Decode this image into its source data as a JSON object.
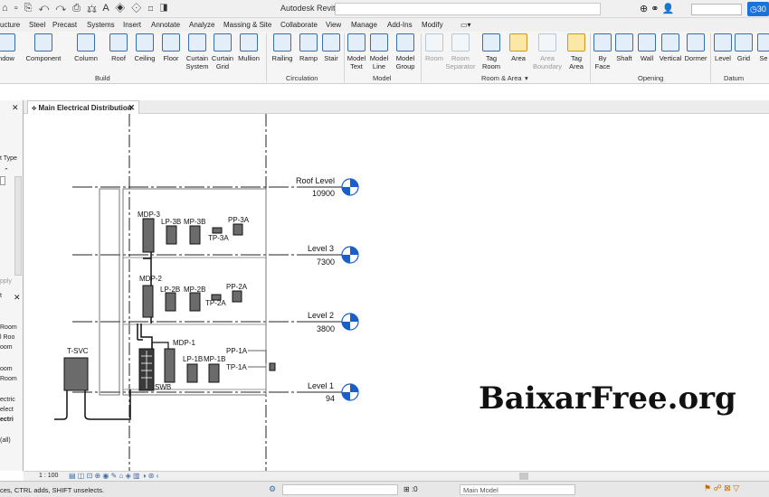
{
  "title_bar": {
    "app_title": "Autodesk Revit",
    "sign_in_counter": "30"
  },
  "menu": {
    "items": [
      "ucture",
      "Steel",
      "Precast",
      "Systems",
      "Insert",
      "Annotate",
      "Analyze",
      "Massing & Site",
      "Collaborate",
      "View",
      "Manage",
      "Add-Ins",
      "Modify"
    ]
  },
  "ribbon": {
    "buttons": [
      "ndow",
      "Component",
      "Column",
      "Roof",
      "Ceiling",
      "Floor",
      "Curtain System",
      "Curtain Grid",
      "Mullion",
      "Railing",
      "Ramp",
      "Stair",
      "Model Text",
      "Model Line",
      "Model Group",
      "Room",
      "Room Separator",
      "Tag Room",
      "Area",
      "Area Boundary",
      "Tag Area",
      "By Face",
      "Shaft",
      "Wall",
      "Vertical",
      "Dormer",
      "Level",
      "Grid",
      "Se"
    ],
    "groups": [
      "Build",
      "Circulation",
      "Model",
      "Room & Area",
      "Opening",
      "Datum"
    ]
  },
  "left_panel": {
    "items": [
      "t Type",
      "pply",
      "t",
      "Room",
      "l Roo",
      "oom",
      "oom",
      "Room",
      "ectric",
      "elect",
      "ectri",
      "(all)"
    ]
  },
  "view_tab": {
    "label": "Main Electrical Distribution"
  },
  "levels": [
    {
      "name": "Roof Level",
      "elevation": "10900"
    },
    {
      "name": "Level 3",
      "elevation": "7300"
    },
    {
      "name": "Level 2",
      "elevation": "3800"
    },
    {
      "name": "Level 1",
      "elevation": "94"
    }
  ],
  "equipment": {
    "level3": [
      "MDP-3",
      "LP-3B",
      "MP-3B",
      "TP-3A",
      "PP-3A"
    ],
    "level2": [
      "MDP-2",
      "LP-2B",
      "MP-2B",
      "TP-2A",
      "PP-2A"
    ],
    "level1": [
      "MDP-1",
      "LP-1B",
      "MP-1B",
      "PP-1A",
      "TP-1A",
      "SWB"
    ],
    "service": "T-SVC"
  },
  "watermark": "BaixarFree.org",
  "view_control": {
    "scale": "1 : 100"
  },
  "status": {
    "message": "ces, CTRL adds, SHIFT unselects.",
    "selection_count": ":0",
    "active_model": "Main Model"
  },
  "colors": {
    "accent": "#1a73d9",
    "icon_blue": "#3b6ea8",
    "level_marker": "#1a5fc9"
  }
}
